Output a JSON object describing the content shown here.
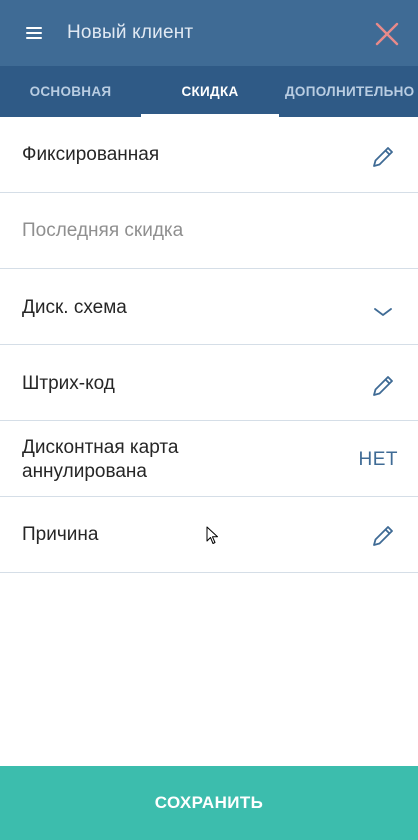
{
  "header": {
    "title": "Новый клиент",
    "menu_icon": "hamburger-menu-icon",
    "close_icon": "close-icon"
  },
  "tabs": [
    {
      "label": "ОСНОВНАЯ",
      "active": false
    },
    {
      "label": "СКИДКА",
      "active": true
    },
    {
      "label": "ДОПОЛНИТЕЛЬНО",
      "active": false
    }
  ],
  "rows": [
    {
      "label": "Фиксированная",
      "icon": "pencil-icon"
    },
    {
      "label": "Последняя скидка"
    },
    {
      "label": "Диск. схема",
      "icon": "chevron-down-icon"
    },
    {
      "label": "Штрих-код",
      "icon": "pencil-icon"
    },
    {
      "label_line1": "Дисконтная карта",
      "label_line2": "аннулирована",
      "value": "НЕТ"
    },
    {
      "label": "Причина",
      "icon": "pencil-icon"
    }
  ],
  "footer": {
    "save_label": "СОХРАНИТЬ"
  },
  "colors": {
    "header": "#3f6b95",
    "tabs": "#2f5a86",
    "save": "#3cbdad",
    "accent": "#3f6b95"
  }
}
